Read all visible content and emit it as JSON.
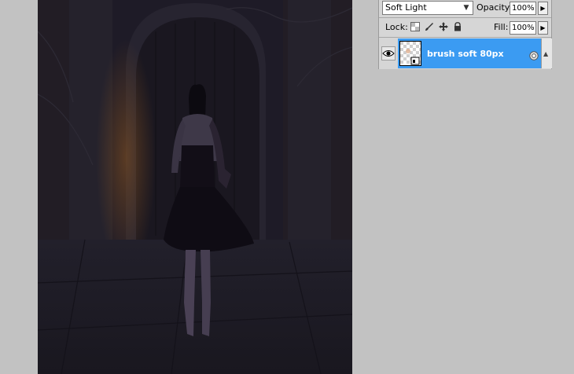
{
  "canvas": {
    "description_icon": "document-photo"
  },
  "layers_panel": {
    "blend_mode": "Soft Light",
    "opacity_label": "Opacity:",
    "opacity_value": "100%",
    "lock_label": "Lock:",
    "fill_label": "Fill:",
    "fill_value": "100%",
    "layer": {
      "name": "brush soft 80px",
      "selected": true,
      "visible": true
    }
  },
  "colors": {
    "workspace": "#c2c2c2",
    "panel": "#d6d6d6",
    "selection": "#3b9bf2",
    "canvas_dark": "#1c1a26"
  }
}
